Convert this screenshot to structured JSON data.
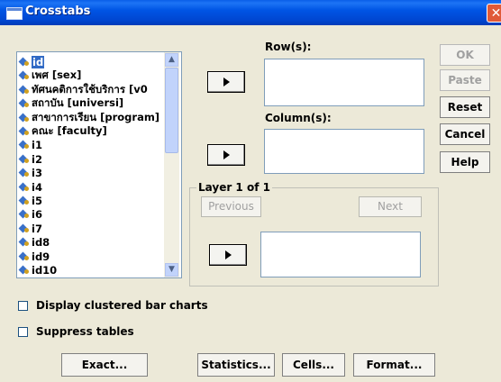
{
  "window": {
    "title": "Crosstabs",
    "close_glyph": "✕"
  },
  "variables": [
    {
      "label": "id",
      "selected": true
    },
    {
      "label": "เพศ [sex]"
    },
    {
      "label": "ทัศนคติการใช้บริการ [v0"
    },
    {
      "label": "สถาบัน [universi]"
    },
    {
      "label": "สาขาการเรียน [program]"
    },
    {
      "label": "คณะ [faculty]"
    },
    {
      "label": "i1"
    },
    {
      "label": "i2"
    },
    {
      "label": "i3"
    },
    {
      "label": "i4"
    },
    {
      "label": "i5"
    },
    {
      "label": "i6"
    },
    {
      "label": "i7"
    },
    {
      "label": "id8"
    },
    {
      "label": "id9"
    },
    {
      "label": "id10"
    }
  ],
  "labels": {
    "rows": "Row(s):",
    "columns": "Column(s):",
    "layer": "Layer 1 of 1"
  },
  "layer_buttons": {
    "previous": "Previous",
    "next": "Next"
  },
  "side_buttons": {
    "ok": "OK",
    "paste": "Paste",
    "reset": "Reset",
    "cancel": "Cancel",
    "help": "Help"
  },
  "checkboxes": {
    "clustered": "Display clustered bar charts",
    "suppress": "Suppress tables"
  },
  "bottom_buttons": {
    "exact": "Exact...",
    "statistics": "Statistics...",
    "cells": "Cells...",
    "format": "Format..."
  },
  "icons": {
    "variable": "numeric-variable-icon",
    "arrow": "right-arrow-icon",
    "scroll_up": "▲",
    "scroll_down": "▼"
  }
}
